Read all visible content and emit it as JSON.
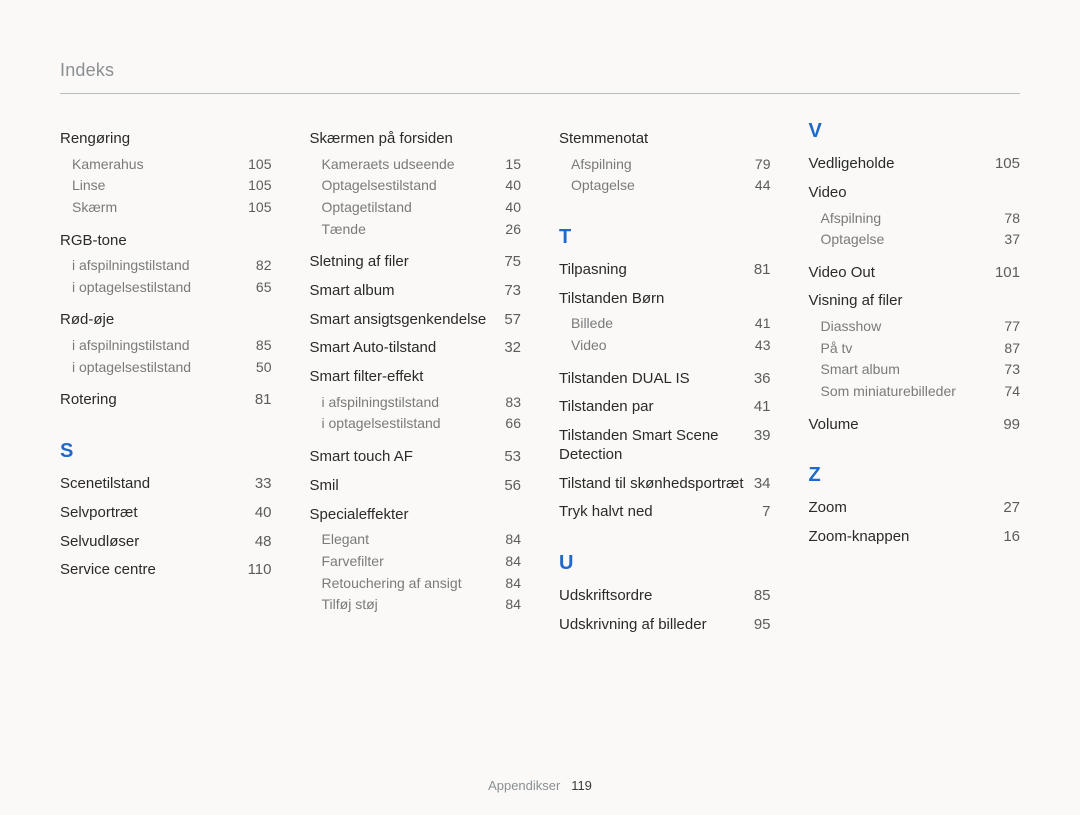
{
  "header": {
    "title": "Indeks"
  },
  "footer": {
    "section": "Appendikser",
    "page": "119"
  },
  "columns": [
    {
      "blocks": [
        {
          "type": "group-head",
          "title": "Rengøring",
          "subs": [
            {
              "label": "Kamerahus",
              "page": "105"
            },
            {
              "label": "Linse",
              "page": "105"
            },
            {
              "label": "Skærm",
              "page": "105"
            }
          ]
        },
        {
          "type": "group-head",
          "title": "RGB-tone",
          "subs": [
            {
              "label": "i afspilningstilstand",
              "page": "82"
            },
            {
              "label": "i optagelsestilstand",
              "page": "65"
            }
          ]
        },
        {
          "type": "group-head",
          "title": "Rød-øje",
          "subs": [
            {
              "label": "i afspilningstilstand",
              "page": "85"
            },
            {
              "label": "i optagelsestilstand",
              "page": "50"
            }
          ]
        },
        {
          "type": "entry",
          "label": "Rotering",
          "page": "81"
        },
        {
          "type": "letter",
          "letter": "S"
        },
        {
          "type": "entry",
          "label": "Scenetilstand",
          "page": "33"
        },
        {
          "type": "entry",
          "label": "Selvportræt",
          "page": "40"
        },
        {
          "type": "entry",
          "label": "Selvudløser",
          "page": "48"
        },
        {
          "type": "entry",
          "label": "Service centre",
          "page": "110"
        }
      ]
    },
    {
      "blocks": [
        {
          "type": "group-head",
          "title": "Skærmen på forsiden",
          "subs": [
            {
              "label": "Kameraets udseende",
              "page": "15"
            },
            {
              "label": "Optagelsestilstand",
              "page": "40"
            },
            {
              "label": "Optagetilstand",
              "page": "40"
            },
            {
              "label": "Tænde",
              "page": "26"
            }
          ]
        },
        {
          "type": "entry",
          "label": "Sletning af filer",
          "page": "75"
        },
        {
          "type": "entry",
          "label": "Smart album",
          "page": "73"
        },
        {
          "type": "entry",
          "label": "Smart ansigtsgenkendelse",
          "page": "57"
        },
        {
          "type": "entry",
          "label": "Smart Auto-tilstand",
          "page": "32"
        },
        {
          "type": "group-head",
          "title": "Smart filter-effekt",
          "subs": [
            {
              "label": "i afspilningstilstand",
              "page": "83"
            },
            {
              "label": "i optagelsestilstand",
              "page": "66"
            }
          ]
        },
        {
          "type": "entry",
          "label": "Smart touch AF",
          "page": "53"
        },
        {
          "type": "entry",
          "label": "Smil",
          "page": "56"
        },
        {
          "type": "group-head",
          "title": "Specialeffekter",
          "subs": [
            {
              "label": "Elegant",
              "page": "84"
            },
            {
              "label": "Farvefilter",
              "page": "84"
            },
            {
              "label": "Retouchering af ansigt",
              "page": "84"
            },
            {
              "label": "Tilføj støj",
              "page": "84"
            }
          ]
        }
      ]
    },
    {
      "blocks": [
        {
          "type": "group-head",
          "title": "Stemmenotat",
          "subs": [
            {
              "label": "Afspilning",
              "page": "79"
            },
            {
              "label": "Optagelse",
              "page": "44"
            }
          ]
        },
        {
          "type": "letter",
          "letter": "T"
        },
        {
          "type": "entry",
          "label": "Tilpasning",
          "page": "81"
        },
        {
          "type": "group-head",
          "title": "Tilstanden Børn",
          "subs": [
            {
              "label": "Billede",
              "page": "41"
            },
            {
              "label": "Video",
              "page": "43"
            }
          ]
        },
        {
          "type": "entry",
          "label": "Tilstanden DUAL IS",
          "page": "36"
        },
        {
          "type": "entry",
          "label": "Tilstanden par",
          "page": "41"
        },
        {
          "type": "entry",
          "label": "Tilstanden Smart Scene Detection",
          "page": "39"
        },
        {
          "type": "entry",
          "label": "Tilstand til skønhedsportræt",
          "page": "34"
        },
        {
          "type": "entry",
          "label": "Tryk halvt ned",
          "page": "7"
        },
        {
          "type": "letter",
          "letter": "U"
        },
        {
          "type": "entry",
          "label": "Udskriftsordre",
          "page": "85"
        },
        {
          "type": "entry",
          "label": "Udskrivning af billeder",
          "page": "95"
        }
      ]
    },
    {
      "blocks": [
        {
          "type": "letter",
          "letter": "V",
          "first": true
        },
        {
          "type": "entry",
          "label": "Vedligeholde",
          "page": "105"
        },
        {
          "type": "group-head",
          "title": "Video",
          "subs": [
            {
              "label": "Afspilning",
              "page": "78"
            },
            {
              "label": "Optagelse",
              "page": "37"
            }
          ]
        },
        {
          "type": "entry",
          "label": "Video Out",
          "page": "101"
        },
        {
          "type": "group-head",
          "title": "Visning af filer",
          "subs": [
            {
              "label": "Diasshow",
              "page": "77"
            },
            {
              "label": "På tv",
              "page": "87"
            },
            {
              "label": "Smart album",
              "page": "73"
            },
            {
              "label": "Som miniaturebilleder",
              "page": "74"
            }
          ]
        },
        {
          "type": "entry",
          "label": "Volume",
          "page": "99"
        },
        {
          "type": "letter",
          "letter": "Z"
        },
        {
          "type": "entry",
          "label": "Zoom",
          "page": "27"
        },
        {
          "type": "entry",
          "label": "Zoom-knappen",
          "page": "16"
        }
      ]
    }
  ]
}
